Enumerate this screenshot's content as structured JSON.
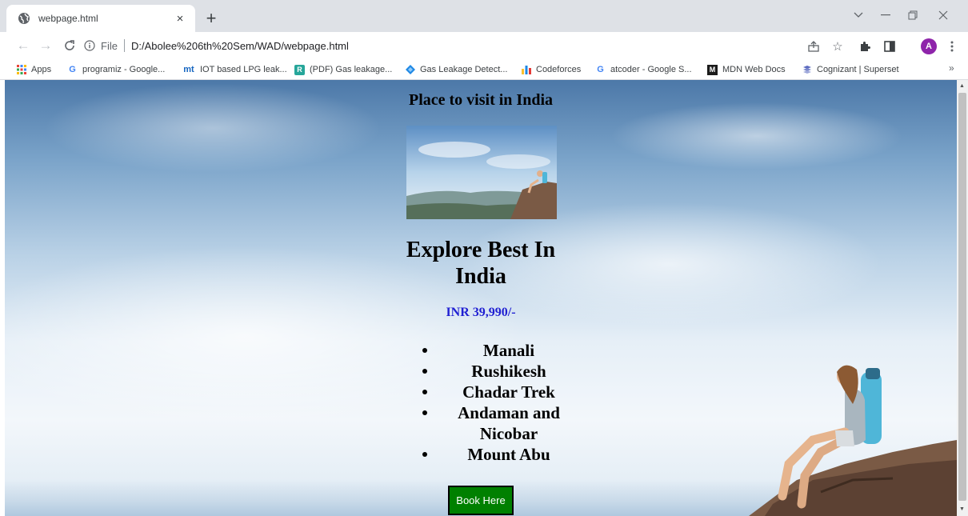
{
  "browser": {
    "tab": {
      "title": "webpage.html",
      "close": "×"
    },
    "new_tab": "+",
    "window_controls": {
      "minimize": "—",
      "restore": "❐",
      "close": "✕"
    },
    "nav": {
      "back": "←",
      "forward": "→",
      "reload": "C"
    },
    "omnibox": {
      "scheme_label": "File",
      "url": "D:/Abolee%206th%20Sem/WAD/webpage.html"
    },
    "profile_initial": "A",
    "bookmarks": [
      {
        "label": "Apps",
        "icon": "apps-grid-icon"
      },
      {
        "label": "programiz - Google...",
        "icon": "google-icon"
      },
      {
        "label": "IOT based LPG leak...",
        "icon": "mt-icon"
      },
      {
        "label": "(PDF) Gas leakage...",
        "icon": "researchgate-icon"
      },
      {
        "label": "Gas Leakage Detect...",
        "icon": "diamond-icon"
      },
      {
        "label": "Codeforces",
        "icon": "codeforces-icon"
      },
      {
        "label": "atcoder - Google S...",
        "icon": "google-icon"
      },
      {
        "label": "MDN Web Docs",
        "icon": "mdn-icon"
      },
      {
        "label": "Cognizant | Superset",
        "icon": "cognizant-icon"
      }
    ],
    "bookmarks_more": "»"
  },
  "page": {
    "heading": "Place to visit in India",
    "explore_title": "Explore Best In India",
    "price": "INR 39,990/-",
    "places": [
      "Manali",
      "Rushikesh",
      "Chadar Trek",
      "Andaman and Nicobar",
      "Mount Abu"
    ],
    "book_button": "Book Here"
  },
  "colors": {
    "price": "#1f1fd2",
    "book_button_bg": "#008000",
    "profile_avatar": "#8e24aa"
  }
}
